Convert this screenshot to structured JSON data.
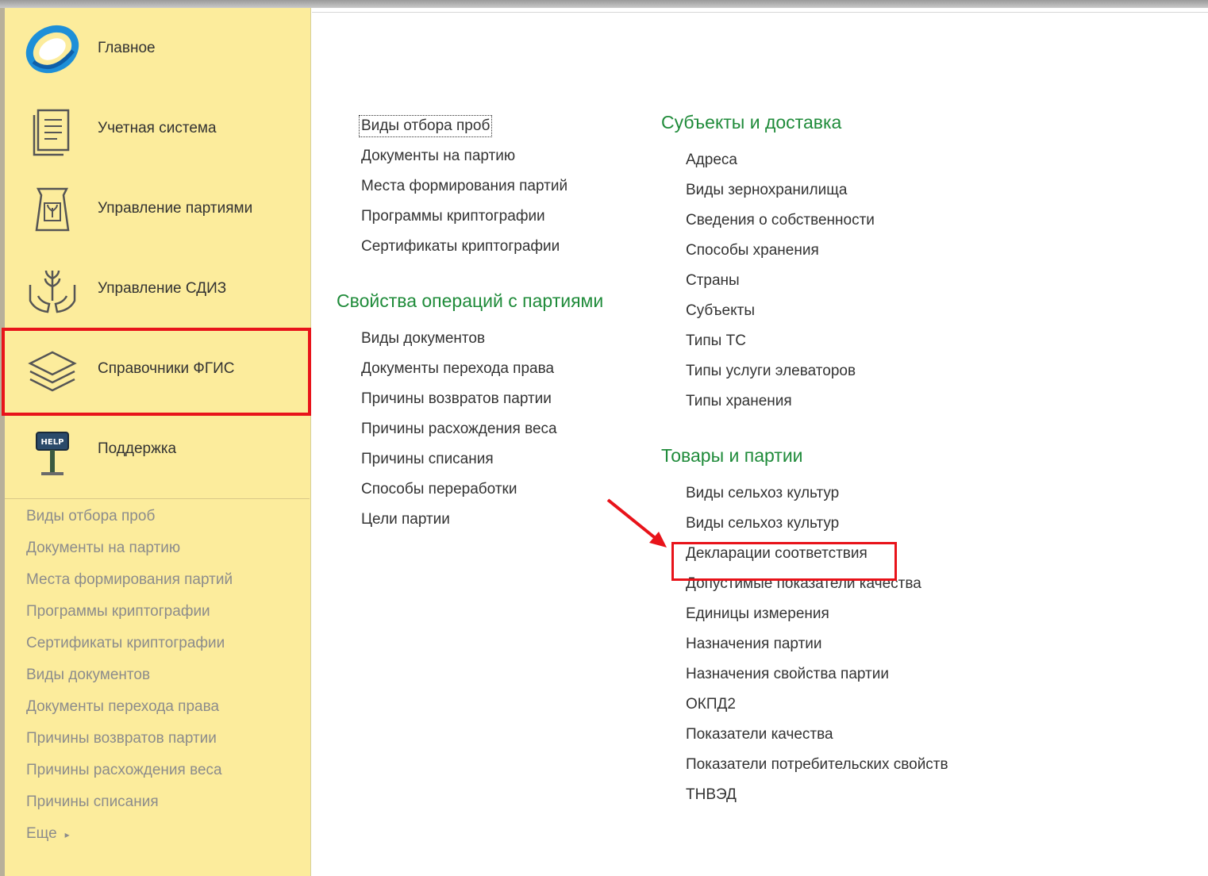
{
  "sidebar": {
    "sections": [
      {
        "label": "Главное",
        "icon": "app-logo-icon"
      },
      {
        "label": "Учетная система",
        "icon": "document-list-icon"
      },
      {
        "label": "Управление партиями",
        "icon": "seed-bag-icon"
      },
      {
        "label": "Управление СДИЗ",
        "icon": "hands-plant-icon"
      },
      {
        "label": "Справочники ФГИС",
        "icon": "layers-icon"
      },
      {
        "label": "Поддержка",
        "icon": "help-sign-icon"
      }
    ],
    "links": [
      "Виды отбора проб",
      "Документы на партию",
      "Места формирования партий",
      "Программы криптографии",
      "Сертификаты криптографии",
      "Виды документов",
      "Документы перехода права",
      "Причины возвратов партии",
      "Причины расхождения веса",
      "Причины списания"
    ],
    "more_label": "Еще"
  },
  "main": {
    "col1_top_links": [
      "Виды отбора проб",
      "Документы на партию",
      "Места формирования партий",
      "Программы криптографии",
      "Сертификаты криптографии"
    ],
    "group_ops": {
      "title": "Свойства операций с партиями",
      "links": [
        "Виды документов",
        "Документы перехода права",
        "Причины возвратов партии",
        "Причины расхождения веса",
        "Причины списания",
        "Способы переработки",
        "Цели партии"
      ]
    },
    "group_subjects": {
      "title": "Субъекты и доставка",
      "links": [
        "Адреса",
        "Виды зернохранилища",
        "Сведения о собственности",
        "Способы хранения",
        "Страны",
        "Субъекты",
        "Типы ТС",
        "Типы услуги элеваторов",
        "Типы хранения"
      ]
    },
    "group_goods": {
      "title": "Товары и партии",
      "links": [
        "Виды сельхоз культур",
        "Виды сельхоз культур",
        "Декларации соответствия",
        "Допустимые показатели качества",
        "Единицы измерения",
        "Назначения партии",
        "Назначения свойства партии",
        "ОКПД2",
        "Показатели качества",
        "Показатели потребительских свойств",
        "ТНВЭД"
      ]
    }
  },
  "colors": {
    "sidebar_bg": "#fcec9c",
    "group_title": "#1f8b3a",
    "highlight": "#e8131a",
    "link_text": "#333333",
    "sidebar_link_text": "#8c8c8c"
  }
}
